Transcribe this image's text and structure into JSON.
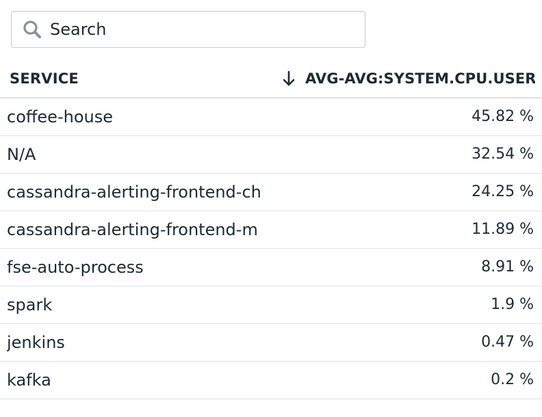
{
  "search": {
    "placeholder": "Search",
    "value": ""
  },
  "table": {
    "columns": [
      {
        "label": "SERVICE"
      },
      {
        "label": "AVG-AVG:SYSTEM.CPU.USER{*} BY {SERVICE}",
        "sort": "descending",
        "sort_icon": "arrow-down-icon"
      }
    ],
    "rows": [
      {
        "service": "coffee-house",
        "value": "45.82 %"
      },
      {
        "service": "N/A",
        "value": "32.54 %"
      },
      {
        "service": "cassandra-alerting-frontend-ch",
        "value": "24.25 %"
      },
      {
        "service": "cassandra-alerting-frontend-m",
        "value": "11.89 %"
      },
      {
        "service": "fse-auto-process",
        "value": "8.91 %"
      },
      {
        "service": "spark",
        "value": "1.9 %"
      },
      {
        "service": "jenkins",
        "value": "0.47 %"
      },
      {
        "service": "kafka",
        "value": "0.2 %"
      }
    ]
  },
  "colors": {
    "text": "#1c2b34",
    "border": "#dfe1e3",
    "search_border": "#c7c9cc",
    "icon": "#8a8f94"
  }
}
